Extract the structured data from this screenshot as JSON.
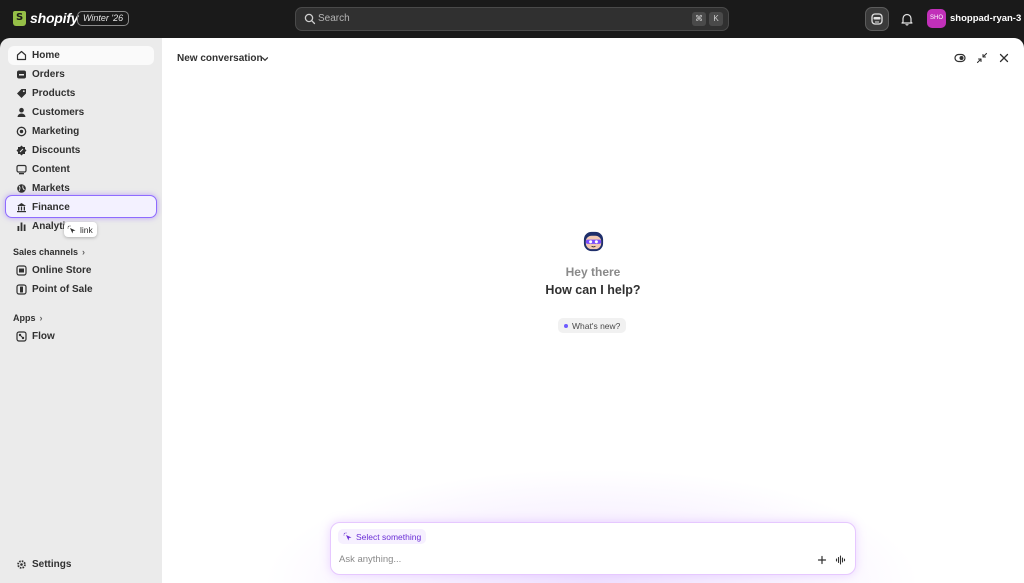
{
  "topbar": {
    "brand": "shopify",
    "edition": "Winter '26",
    "search_placeholder": "Search",
    "kbd_cmd": "⌘",
    "kbd_k": "K",
    "avatar_initials": "SHO",
    "store_name": "shoppad-ryan-3"
  },
  "sidebar": {
    "items": [
      {
        "label": "Home",
        "icon": "home-icon"
      },
      {
        "label": "Orders",
        "icon": "inbox-icon"
      },
      {
        "label": "Products",
        "icon": "tag-icon"
      },
      {
        "label": "Customers",
        "icon": "person-icon"
      },
      {
        "label": "Marketing",
        "icon": "target-icon"
      },
      {
        "label": "Discounts",
        "icon": "discount-icon"
      },
      {
        "label": "Content",
        "icon": "content-icon"
      },
      {
        "label": "Markets",
        "icon": "globe-icon"
      },
      {
        "label": "Finance",
        "icon": "bank-icon"
      },
      {
        "label": "Analytics",
        "icon": "bar-chart-icon"
      }
    ],
    "sales_channels_title": "Sales channels",
    "sales_channels": [
      {
        "label": "Online Store",
        "icon": "store-icon"
      },
      {
        "label": "Point of Sale",
        "icon": "pos-icon"
      }
    ],
    "apps_title": "Apps",
    "apps": [
      {
        "label": "Flow",
        "icon": "flow-icon"
      }
    ],
    "settings_label": "Settings",
    "tooltip": "link",
    "colors": {
      "focus_ring": "#8e6bff"
    }
  },
  "main": {
    "conversation_title": "New conversation",
    "greeting": "Hey there",
    "prompt": "How can I help?",
    "whats_new": "What's new?",
    "select_chip": "Select something",
    "ask_placeholder": "Ask anything...",
    "colors": {
      "accent": "#6b2fd6"
    }
  }
}
